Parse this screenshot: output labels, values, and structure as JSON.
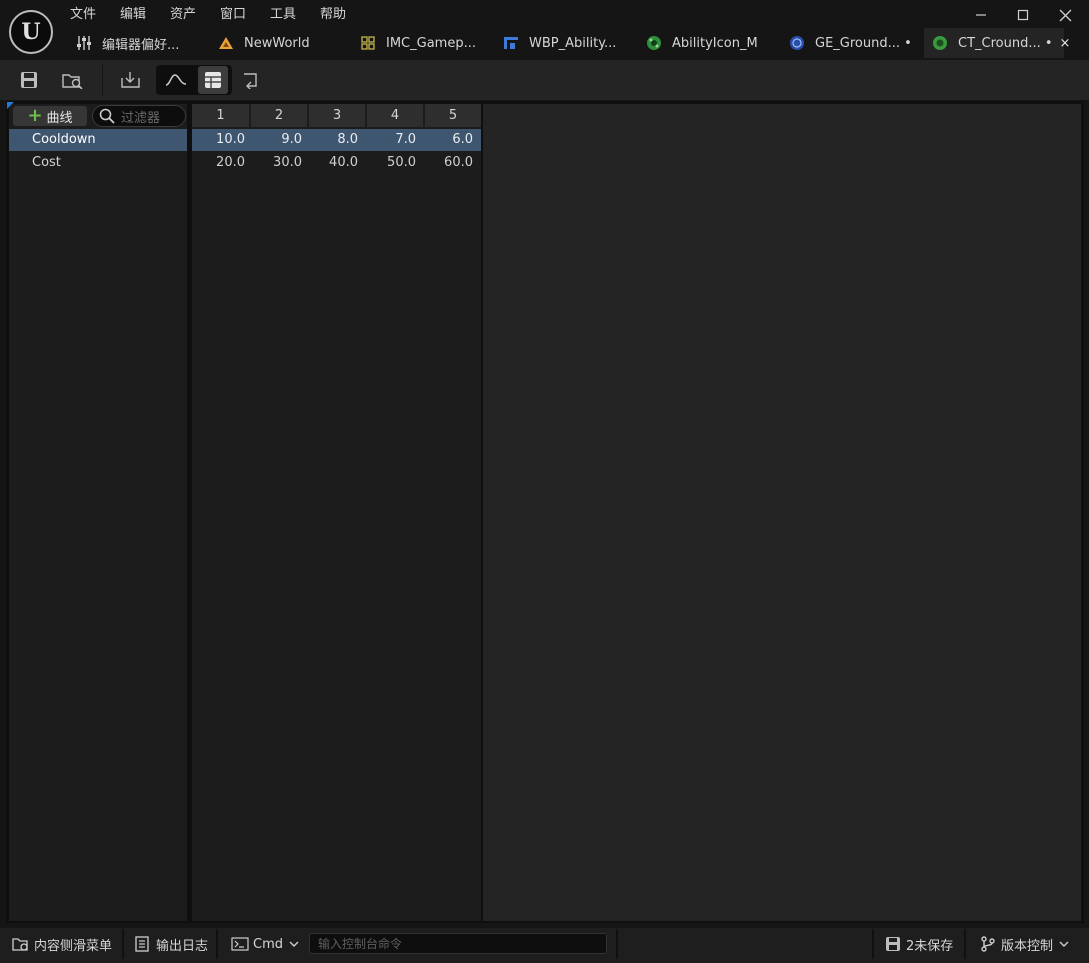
{
  "app": {
    "menu": [
      "文件",
      "编辑",
      "资产",
      "窗口",
      "工具",
      "帮助"
    ]
  },
  "tabs": [
    {
      "label": "编辑器偏好...",
      "icon": "sliders-icon"
    },
    {
      "label": "NewWorld",
      "icon": "level-icon"
    },
    {
      "label": "IMC_Gamep...",
      "icon": "input-mapping-icon"
    },
    {
      "label": "WBP_Ability...",
      "icon": "widget-blueprint-icon"
    },
    {
      "label": "AbilityIcon_M",
      "icon": "material-icon"
    },
    {
      "label": "GE_Ground... •",
      "icon": "blueprint-icon"
    },
    {
      "label": "CT_Cround... •",
      "icon": "curve-table-icon",
      "active": true
    }
  ],
  "toolbar": {
    "buttons": [
      "save-icon",
      "browse-icon",
      "reimport-icon",
      "curve-view-icon",
      "table-view-icon",
      "append-key-icon"
    ]
  },
  "curve_panel": {
    "add_label": "曲线",
    "filter_placeholder": "过滤器",
    "rows": [
      "Cooldown",
      "Cost"
    ]
  },
  "table": {
    "columns": [
      "1",
      "2",
      "3",
      "4",
      "5"
    ],
    "rows": [
      [
        "10.0",
        "9.0",
        "8.0",
        "7.0",
        "6.0"
      ],
      [
        "20.0",
        "30.0",
        "40.0",
        "50.0",
        "60.0"
      ]
    ]
  },
  "statusbar": {
    "content_drawer": "内容侧滑菜单",
    "output_log": "输出日志",
    "cmd": "Cmd",
    "console_placeholder": "输入控制台命令",
    "unsaved": "2未保存",
    "source_control": "版本控制"
  },
  "colors": {
    "selection": "#3f5670",
    "accent_green": "#6cc04a",
    "accent_blue": "#1e7bd6"
  }
}
